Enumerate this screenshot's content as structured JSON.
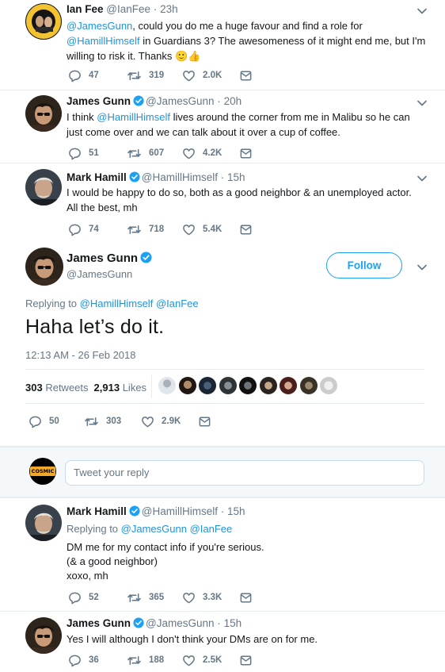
{
  "tweets": [
    {
      "name": "Ian Fee",
      "handle": "@IanFee",
      "time": "23h",
      "text_parts": [
        "",
        "@JamesGunn",
        ", could you do me a huge favour and find a role for ",
        "@HamillHimself",
        " in Guardians 3? The awesomeness of it might end me, but I'm willing to risk it. Thanks ",
        "🙂👍"
      ],
      "replies": "47",
      "retweets": "319",
      "likes": "2.0K"
    },
    {
      "name": "James Gunn",
      "handle": "@JamesGunn",
      "time": "20h",
      "text_parts": [
        "I think ",
        "@HamillHimself",
        " lives around the corner from me in Malibu so he can just come over and we can talk about it over a cup of coffee."
      ],
      "replies": "51",
      "retweets": "607",
      "likes": "4.2K"
    },
    {
      "name": "Mark Hamill",
      "handle": "@HamillHimself",
      "time": "15h",
      "text": "I would be happy to do so, both as a good neighbor & an unemployed actor. All the best, mh",
      "replies": "74",
      "retweets": "718",
      "likes": "5.4K"
    }
  ],
  "main": {
    "name": "James Gunn",
    "handle": "@JamesGunn",
    "follow_label": "Follow",
    "replying_to_label": "Replying to ",
    "replying_to_1": "@HamillHimself",
    "replying_to_2": "@IanFee",
    "text": "Haha let’s do it.",
    "timestamp": "12:13 AM - 26 Feb 2018",
    "retweet_count": "303",
    "retweets_label": "Retweets",
    "like_count": "2,913",
    "likes_label": "Likes",
    "replies": "50",
    "retweets": "303",
    "likes": "2.9K"
  },
  "reply_box": {
    "placeholder": "Tweet your reply",
    "avatar_text": "COSMIC"
  },
  "replies": [
    {
      "name": "Mark Hamill",
      "handle": "@HamillHimself",
      "time": "15h",
      "replying_to_label": "Replying to ",
      "replying_to_1": "@JamesGunn",
      "replying_to_2": "@IanFee",
      "line1": "DM me for my contact info if you're serious.",
      "line2": "(& a good neighbor)",
      "line3": "xoxo, mh",
      "replies": "52",
      "retweets": "365",
      "likes": "3.3K"
    },
    {
      "name": "James Gunn",
      "handle": "@JamesGunn",
      "time": "15h",
      "text": "Yes I will although I don't think your DMs are on for me.",
      "replies": "36",
      "retweets": "188",
      "likes": "2.5K"
    }
  ],
  "colors": {
    "accent": "#1da1f2",
    "link": "#1b95e0",
    "muted": "#657786",
    "divider": "#e6ecf0"
  },
  "icons": [
    "reply-icon",
    "retweet-icon",
    "like-icon",
    "dm-icon",
    "verified-badge-icon",
    "chevron-down-icon"
  ]
}
